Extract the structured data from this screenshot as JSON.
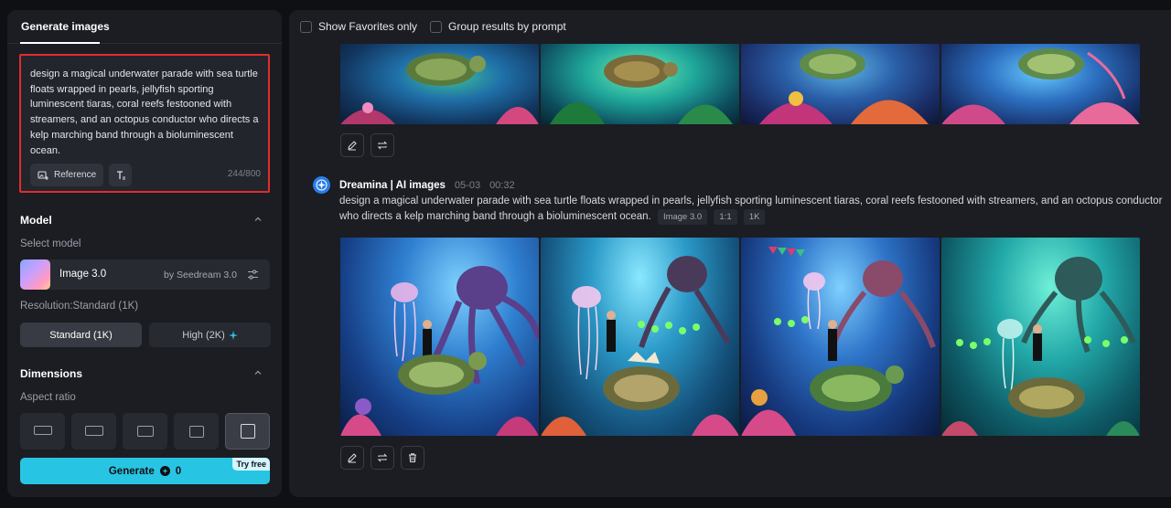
{
  "sidebar": {
    "tab": "Generate images",
    "prompt": " design a magical underwater parade with sea turtle floats wrapped in pearls, jellyfish sporting luminescent tiaras, coral reefs festooned with streamers, and an octopus conductor who directs a kelp marching band through a bioluminescent ocean.",
    "reference_label": "Reference",
    "counter": "244/800",
    "model_title": "Model",
    "select_model_label": "Select model",
    "model_name": "Image 3.0",
    "model_by": "by Seedream 3.0",
    "resolution_label": "Resolution:Standard (1K)",
    "res_standard": "Standard (1K)",
    "res_high": "High (2K)",
    "dimensions_title": "Dimensions",
    "aspect_label": "Aspect ratio",
    "generate_label": "Generate",
    "generate_cost": "0",
    "try_free": "Try free"
  },
  "main": {
    "filter_favorites": "Show Favorites only",
    "filter_group": "Group results by prompt",
    "author": "Dreamina | AI images",
    "date": "05-03",
    "time": "00:32",
    "prompt": "design a magical underwater parade with sea turtle floats wrapped in pearls, jellyfish sporting luminescent tiaras, coral reefs festooned with streamers, and an octopus conductor who directs a kelp marching band through a bioluminescent ocean.",
    "tags": [
      "Image 3.0",
      "1:1",
      "1K"
    ]
  },
  "colors": {
    "accent": "#27c5e3",
    "highlight_border": "#e02d2d",
    "panel": "#1b1d23",
    "background": "#0f1014"
  }
}
